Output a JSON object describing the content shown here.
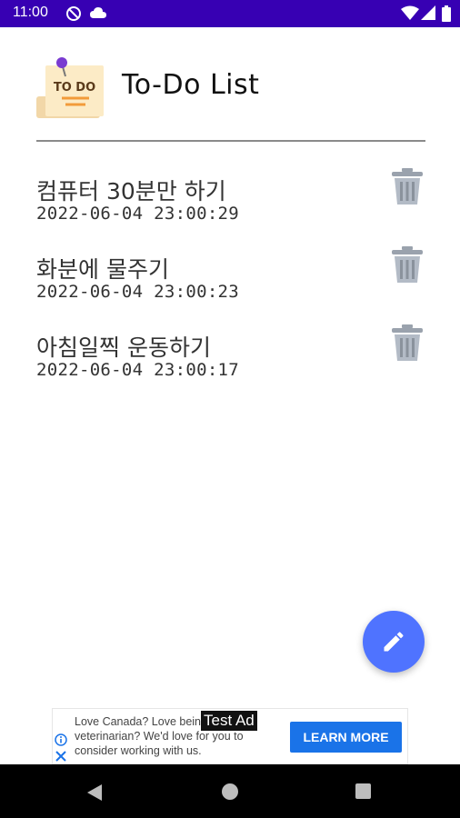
{
  "status_bar": {
    "time": "11:00",
    "icons": [
      "sync-disabled-icon",
      "cloud-icon",
      "wifi-icon",
      "signal-icon",
      "battery-icon"
    ],
    "background": "#3700b3"
  },
  "header": {
    "title": "To-Do List",
    "logo_text": "TO DO"
  },
  "todos": [
    {
      "title": "컴퓨터 30분만 하기",
      "timestamp": "2022-06-04 23:00:29"
    },
    {
      "title": "화분에 물주기",
      "timestamp": "2022-06-04 23:00:23"
    },
    {
      "title": "아침일찍 운동하기",
      "timestamp": "2022-06-04 23:00:17"
    }
  ],
  "fab": {
    "icon": "pencil-icon",
    "color": "#4f73ff"
  },
  "ad": {
    "label": "Test Ad",
    "text": "Love Canada? Love being a veterinarian? We'd love for you to consider working with us.",
    "cta": "LEARN MORE",
    "cta_color": "#1a73e8"
  },
  "nav_bar": {
    "icons": [
      "back-icon",
      "home-icon",
      "recents-icon"
    ]
  }
}
